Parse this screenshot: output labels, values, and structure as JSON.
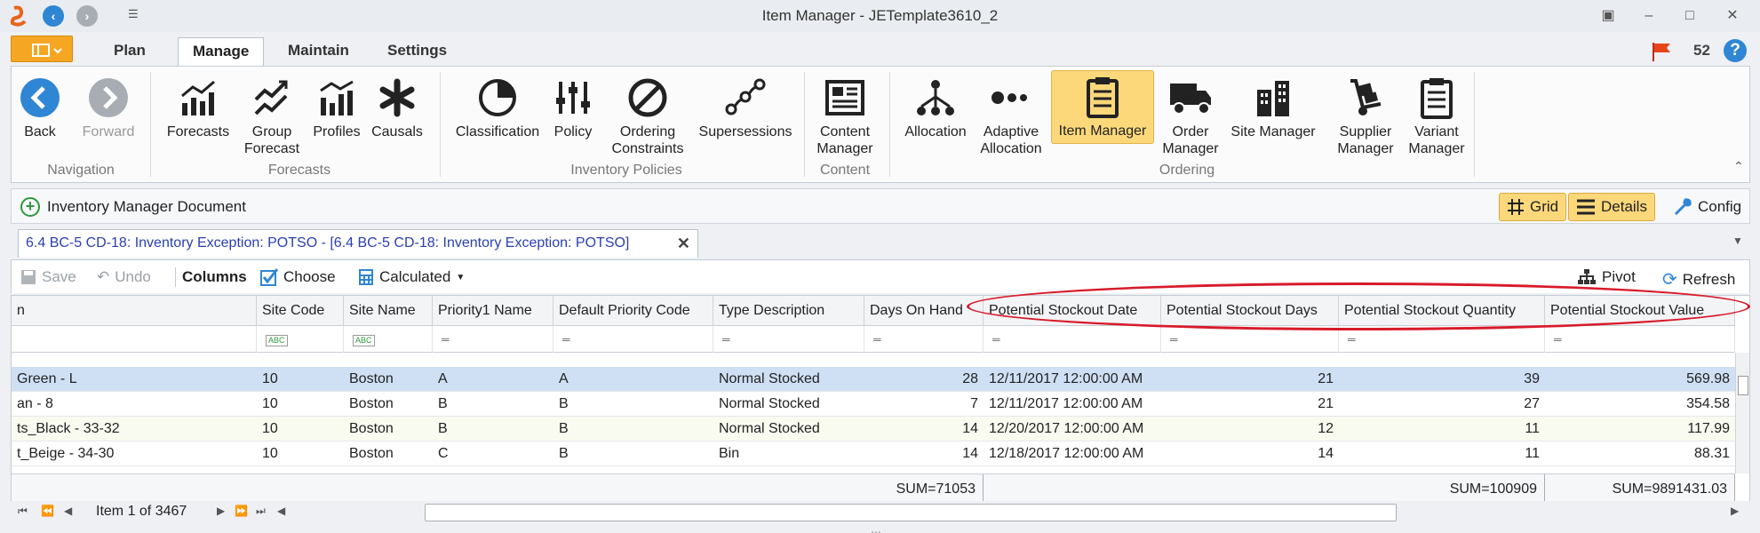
{
  "window": {
    "title": "Item Manager - JETemplate3610_2"
  },
  "ribbon_tabs": [
    "Plan",
    "Manage",
    "Maintain",
    "Settings"
  ],
  "notifications": {
    "count": "52"
  },
  "ribbon": {
    "back": "Back",
    "forward": "Forward",
    "navigation_group": "Navigation",
    "forecasts": "Forecasts",
    "group_forecast": "Group\nForecast",
    "profiles": "Profiles",
    "causals": "Causals",
    "forecasts_group": "Forecasts",
    "classification": "Classification",
    "policy": "Policy",
    "ordering_constraints": "Ordering\nConstraints",
    "supersessions": "Supersessions",
    "inventory_group": "Inventory Policies",
    "content_manager": "Content\nManager",
    "content_group": "Content",
    "allocation": "Allocation",
    "adaptive_allocation": "Adaptive\nAllocation",
    "item_manager": "Item Manager",
    "order_manager": "Order\nManager",
    "site_manager": "Site Manager",
    "supplier_manager": "Supplier\nManager",
    "variant_manager": "Variant\nManager",
    "ordering_group": "Ordering"
  },
  "docbar": {
    "title": "Inventory Manager Document",
    "grid": "Grid",
    "details": "Details",
    "config": "Config"
  },
  "doc_tab": {
    "label": "6.4  BC-5 CD-18: Inventory Exception: POTSO - [6.4  BC-5 CD-18: Inventory Exception: POTSO]"
  },
  "grid_toolbar": {
    "save": "Save",
    "undo": "Undo",
    "columns": "Columns",
    "choose": "Choose",
    "calculated": "Calculated",
    "pivot": "Pivot",
    "refresh": "Refresh"
  },
  "columns": [
    "n",
    "Site Code",
    "Site Name",
    "Priority1 Name",
    "Default Priority Code",
    "Type Description",
    "Days On Hand",
    "Potential Stockout Date",
    "Potential Stockout Days",
    "Potential Stockout Quantity",
    "Potential Stockout Value"
  ],
  "rows": [
    [
      "Green - L",
      "10",
      "Boston",
      "A",
      "A",
      "Normal Stocked",
      "28",
      "12/11/2017 12:00:00 AM",
      "21",
      "39",
      "569.98"
    ],
    [
      "an - 8",
      "10",
      "Boston",
      "B",
      "B",
      "Normal Stocked",
      "7",
      "12/11/2017 12:00:00 AM",
      "21",
      "27",
      "354.58"
    ],
    [
      "ts_Black - 33-32",
      "10",
      "Boston",
      "B",
      "B",
      "Normal Stocked",
      "14",
      "12/20/2017 12:00:00 AM",
      "12",
      "11",
      "117.99"
    ],
    [
      "t_Beige - 34-30",
      "10",
      "Boston",
      "C",
      "B",
      "Bin",
      "14",
      "12/18/2017 12:00:00 AM",
      "14",
      "11",
      "88.31"
    ]
  ],
  "sums": {
    "days_on_hand": "SUM=71053",
    "quantity": "SUM=100909",
    "value": "SUM=9891431.03"
  },
  "pager": {
    "label": "Item 1 of 3467"
  },
  "colors": {
    "accent": "#fcd87a",
    "annotation": "#d81a2a",
    "tab_text": "#2a3fb2"
  }
}
